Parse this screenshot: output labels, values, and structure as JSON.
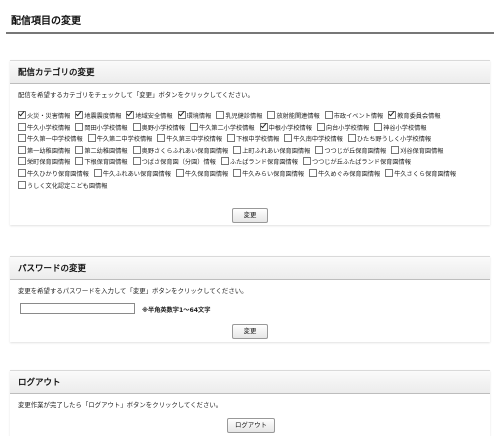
{
  "page": {
    "title": "配信項目の変更"
  },
  "category_section": {
    "title": "配信カテゴリの変更",
    "description": "配信を希望するカテゴリをチェックして「変更」ボタンをクリックしてください。",
    "items": [
      {
        "label": "火災・災害情報",
        "checked": true
      },
      {
        "label": "地震震度情報",
        "checked": true
      },
      {
        "label": "地域安全情報",
        "checked": true
      },
      {
        "label": "環境情報",
        "checked": true
      },
      {
        "label": "乳児健診情報",
        "checked": false
      },
      {
        "label": "放射能関連情報",
        "checked": false
      },
      {
        "label": "市政イベント情報",
        "checked": false
      },
      {
        "label": "教育委員会情報",
        "checked": true
      },
      {
        "label": "牛久小学校情報",
        "checked": false
      },
      {
        "label": "岡田小学校情報",
        "checked": false
      },
      {
        "label": "奥野小学校情報",
        "checked": false
      },
      {
        "label": "牛久第二小学校情報",
        "checked": false
      },
      {
        "label": "中根小学校情報",
        "checked": true
      },
      {
        "label": "向台小学校情報",
        "checked": false
      },
      {
        "label": "神谷小学校情報",
        "checked": false
      },
      {
        "label": "牛久第一中学校情報",
        "checked": false
      },
      {
        "label": "牛久第二中学校情報",
        "checked": false
      },
      {
        "label": "牛久第三中学校情報",
        "checked": false
      },
      {
        "label": "下根中学校情報",
        "checked": false
      },
      {
        "label": "牛久南中学校情報",
        "checked": false
      },
      {
        "label": "ひたち野うしく小学校情報",
        "checked": false
      },
      {
        "label": "第一幼稚園情報",
        "checked": false
      },
      {
        "label": "第二幼稚園情報",
        "checked": false
      },
      {
        "label": "奥野さくらふれあい保育園情報",
        "checked": false
      },
      {
        "label": "上町ふれあい保育園情報",
        "checked": false
      },
      {
        "label": "つつじが丘保育園情報",
        "checked": false
      },
      {
        "label": "刈谷保育園情報",
        "checked": false
      },
      {
        "label": "栄町保育園情報",
        "checked": false
      },
      {
        "label": "下根保育園情報",
        "checked": false
      },
      {
        "label": "つばさ保育園（分園）情報",
        "checked": false
      },
      {
        "label": "ふたばランド保育園情報",
        "checked": false
      },
      {
        "label": "つつじが丘ふたばランド保育園情報",
        "checked": false
      },
      {
        "label": "牛久ひかり保育園情報",
        "checked": false
      },
      {
        "label": "牛久ふれあい保育園情報",
        "checked": false
      },
      {
        "label": "牛久保育園情報",
        "checked": false
      },
      {
        "label": "牛久みらい保育園情報",
        "checked": false
      },
      {
        "label": "牛久めぐみ保育園情報",
        "checked": false
      },
      {
        "label": "牛久さくら保育園情報",
        "checked": false
      },
      {
        "label": "うしく文化認定こども園情報",
        "checked": false
      }
    ],
    "button_label": "変更"
  },
  "password_section": {
    "title": "パスワードの変更",
    "description": "変更を希望するパスワードを入力して「変更」ボタンをクリックしてください。",
    "input_value": "",
    "input_placeholder": "",
    "note": "※半角英数字1～64文字",
    "button_label": "変更"
  },
  "logout_section": {
    "title": "ログアウト",
    "description": "変更作業が完了したら「ログアウト」ボタンをクリックしてください。",
    "button_label": "ログアウト"
  }
}
